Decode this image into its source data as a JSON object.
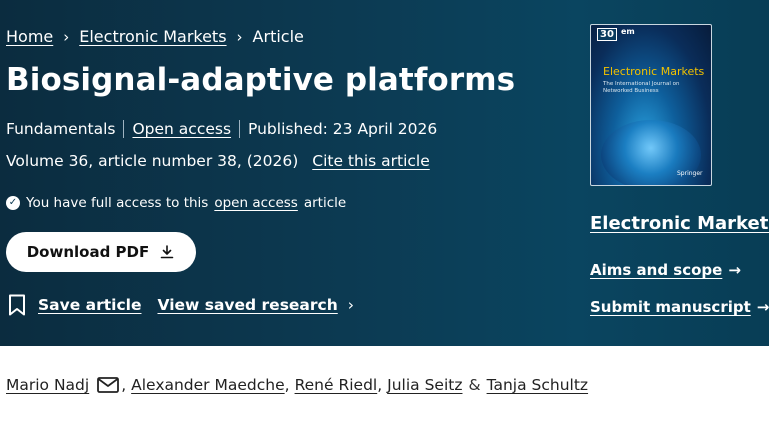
{
  "breadcrumb": {
    "items": [
      "Home",
      "Electronic Markets",
      "Article"
    ],
    "separator": "›"
  },
  "article": {
    "title": "Biosignal-adaptive platforms",
    "type": "Fundamentals",
    "access_type": "Open access",
    "published": "Published: 23 April 2026",
    "volume": "Volume 36, article number 38, (2026)",
    "cite_label": "Cite this article",
    "access_note_prefix": "You have full access to this",
    "access_note_link": "open access",
    "access_note_suffix": "article"
  },
  "actions": {
    "download_label": "Download PDF",
    "save_label": "Save article",
    "view_saved_label": "View saved research"
  },
  "journal": {
    "name": "Electronic Markets",
    "cover_badge": "30",
    "cover_abbrev": "em",
    "cover_title": "Electronic Markets",
    "cover_subtitle": "The International Journal on Networked Business",
    "cover_publisher": "Springer",
    "aims_label": "Aims and scope",
    "submit_label": "Submit manuscript"
  },
  "authors": {
    "first": "Mario Nadj",
    "middle": [
      "Alexander Maedche",
      "René Riedl",
      "Julia Seitz"
    ],
    "last": "Tanja Schultz",
    "and_symbol": "&"
  },
  "colors": {
    "hero_background": "#0c3a52",
    "accent_link": "#ffffff",
    "body_text": "#222222"
  }
}
